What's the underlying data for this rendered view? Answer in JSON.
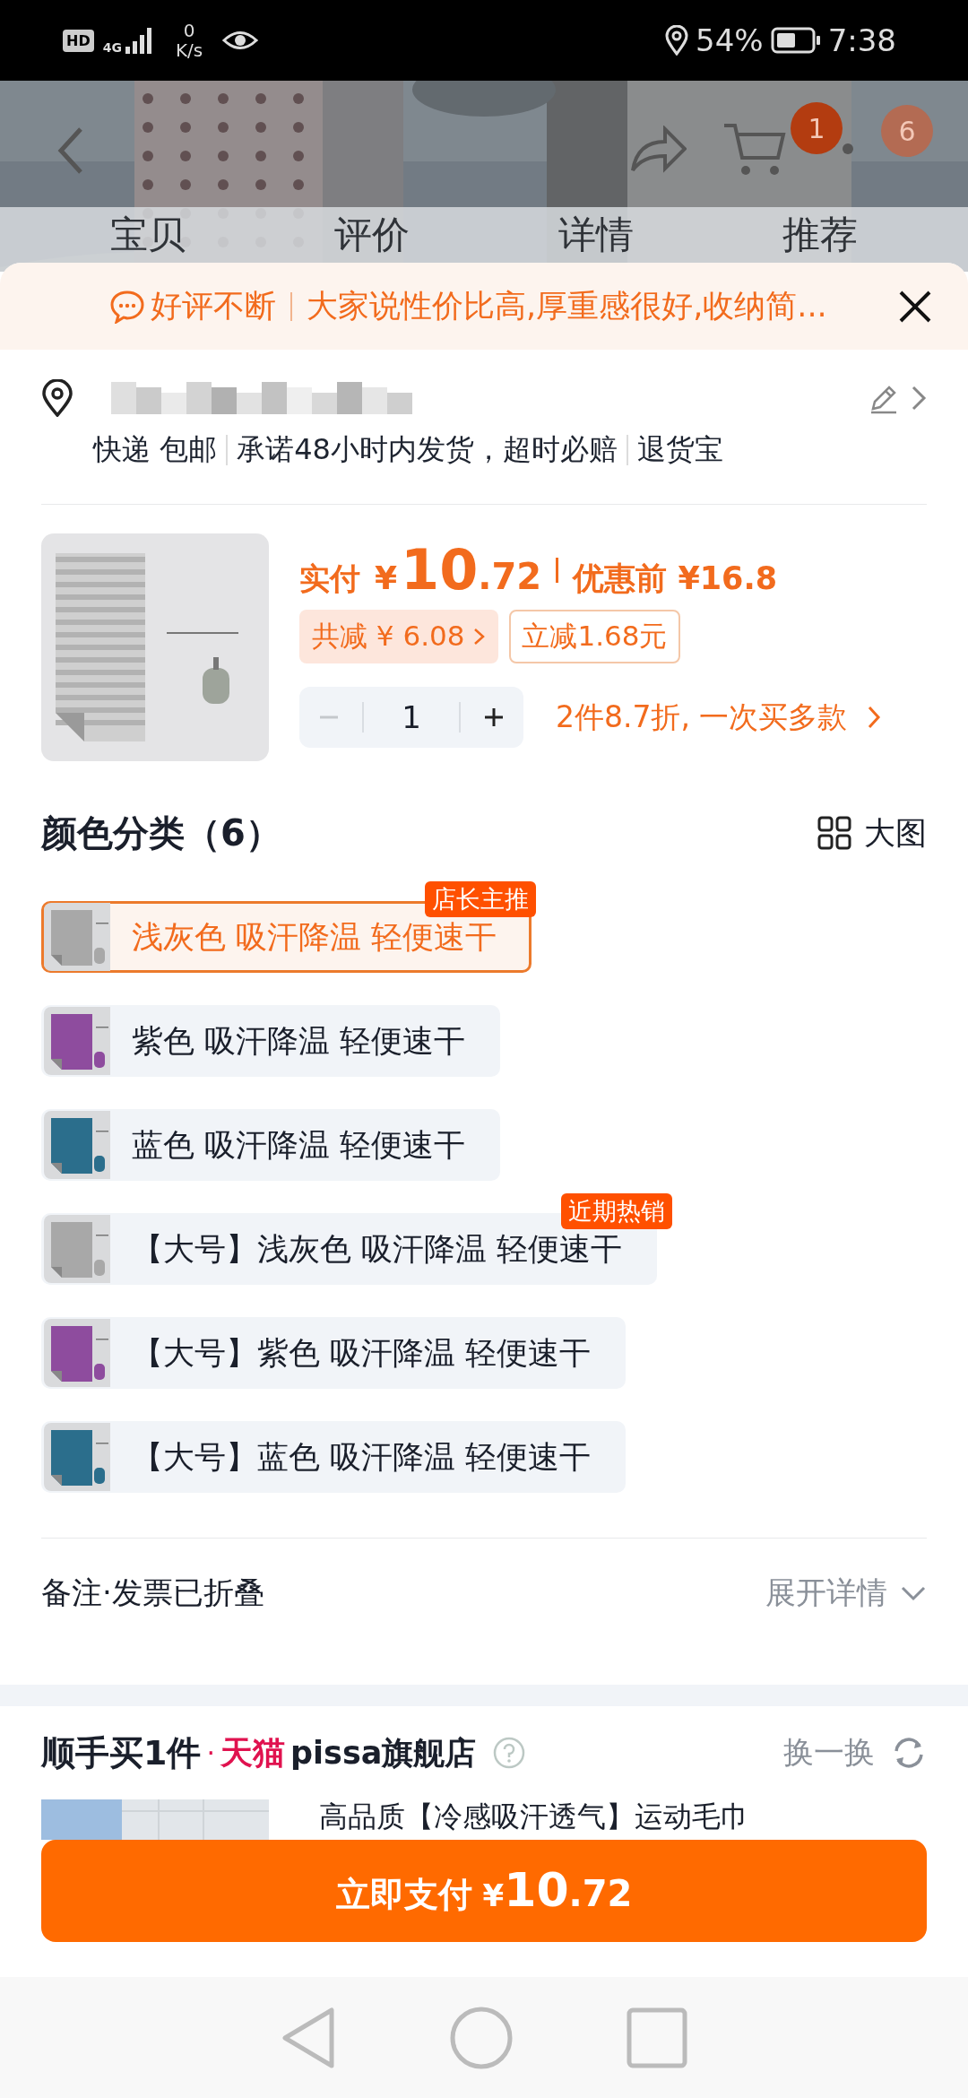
{
  "status_bar": {
    "hd": "HD",
    "network": "4G",
    "speed_value": "0",
    "speed_unit": "K/s",
    "battery": "54%",
    "time": "7:38"
  },
  "header": {
    "cart_badge": "1",
    "more_badge": "6",
    "tabs": [
      "宝贝",
      "评价",
      "详情",
      "推荐"
    ]
  },
  "banner": {
    "title": "好评不断",
    "text": "大家说性价比高,厚重感很好,收纳简..."
  },
  "address": {
    "delivery": [
      "快递 包邮",
      "承诺48小时内发货，超时必赔",
      "退货宝"
    ]
  },
  "product": {
    "price_label": "实付",
    "currency": "¥",
    "price_int": "10",
    "price_dec": ".72",
    "original": "优惠前 ¥16.8",
    "discount_total": "共减 ¥ 6.08",
    "instant_discount": "立减1.68元",
    "quantity": "1",
    "decrease_disabled": true,
    "multi_buy": "2件8.7折, 一次买多款"
  },
  "options": {
    "title": "颜色分类（6）",
    "big_view": "大图",
    "items": [
      {
        "label": "浅灰色 吸汗降温 轻便速干",
        "selected": true,
        "color": "#a8a8a8",
        "badge": "店长主推"
      },
      {
        "label": "紫色 吸汗降温 轻便速干",
        "selected": false,
        "color": "#8e4c9e"
      },
      {
        "label": "蓝色 吸汗降温 轻便速干",
        "selected": false,
        "color": "#2b6e8c"
      },
      {
        "label": "【大号】浅灰色 吸汗降温 轻便速干",
        "selected": false,
        "color": "#a8a8a8",
        "badge": "近期热销"
      },
      {
        "label": "【大号】紫色 吸汗降温 轻便速干",
        "selected": false,
        "color": "#8e4c9e"
      },
      {
        "label": "【大号】蓝色 吸汗降温 轻便速干",
        "selected": false,
        "color": "#2b6e8c"
      }
    ]
  },
  "remarks": {
    "label": "备注·发票已折叠",
    "action": "展开详情"
  },
  "add_on": {
    "title": "顺手买1件",
    "separator": "·",
    "brand": "天猫",
    "store": "pissa旗舰店",
    "refresh": "换一换",
    "product_title": "高品质【冷感吸汗透气】运动毛巾"
  },
  "pay_button": {
    "label": "立即支付",
    "currency": "¥",
    "price_int": "10",
    "price_dec": ".72"
  }
}
